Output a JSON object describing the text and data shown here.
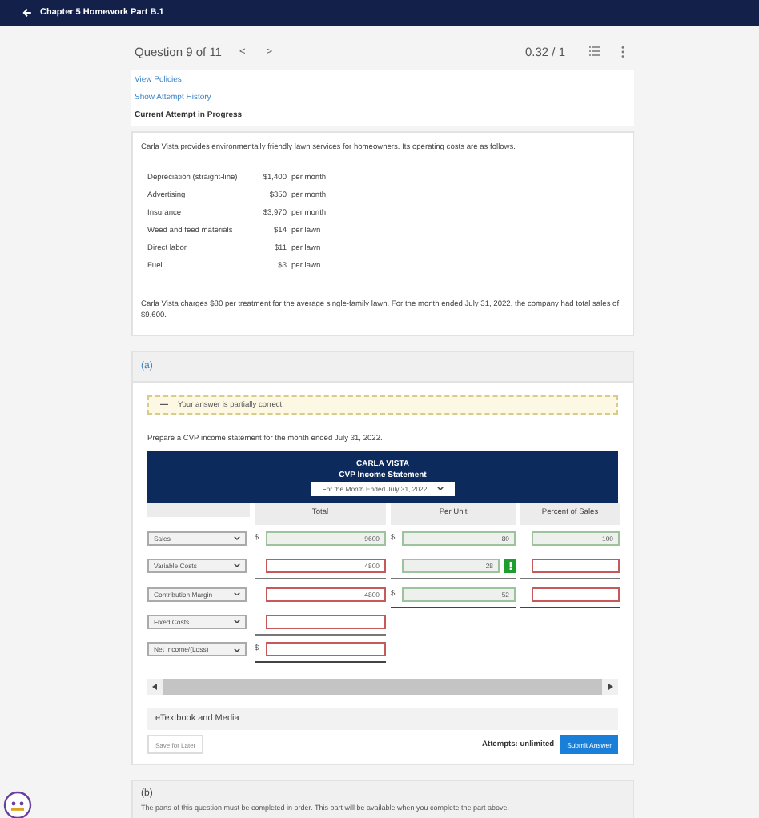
{
  "header": {
    "title": "Chapter 5 Homework Part B.1"
  },
  "question": {
    "label": "Question 9 of 11",
    "prev": "<",
    "next": ">",
    "score": "0.32 / 1"
  },
  "links": [
    "View Policies",
    "Show Attempt History"
  ],
  "attempt_heading": "Current Attempt in Progress",
  "problem": {
    "intro": "Carla Vista provides environmentally friendly lawn services for homeowners. Its operating costs are as follows.",
    "costs": [
      {
        "item": "Depreciation (straight-line)",
        "amount": "$1,400",
        "basis": "per month"
      },
      {
        "item": "Advertising",
        "amount": "$350",
        "basis": "per month"
      },
      {
        "item": "Insurance",
        "amount": "$3,970",
        "basis": "per month"
      },
      {
        "item": "Weed and feed materials",
        "amount": "$14",
        "basis": "per lawn"
      },
      {
        "item": "Direct labor",
        "amount": "$11",
        "basis": "per lawn"
      },
      {
        "item": "Fuel",
        "amount": "$3",
        "basis": "per lawn"
      }
    ],
    "closing": "Carla Vista charges $80 per treatment for the average single-family lawn. For the month ended July 31, 2022, the company had total sales of $9,600."
  },
  "part_a": {
    "label": "(a)",
    "feedback": {
      "sign": "—",
      "text": "Your answer is partially correct."
    },
    "instruction": "Prepare a CVP income statement for the month ended July 31, 2022.",
    "statement": {
      "company": "CARLA VISTA",
      "title": "CVP Income Statement",
      "period": "For the Month Ended July 31, 2022",
      "columns": [
        "Total",
        "Per Unit",
        "Percent of Sales"
      ],
      "rows": [
        {
          "label": "Sales",
          "cells": [
            {
              "prefix": "$",
              "value": "9600",
              "correct": true,
              "ruled": false,
              "flagged": false
            },
            {
              "prefix": "$",
              "value": "80",
              "correct": true,
              "ruled": false,
              "flagged": false
            },
            {
              "value": "100",
              "correct": true,
              "ruled": false,
              "flagged": false
            }
          ]
        },
        {
          "label": "Variable Costs",
          "cells": [
            {
              "value": "4800",
              "correct": false,
              "ruled": true,
              "heavy_rule": false,
              "flagged": false
            },
            {
              "value": "28",
              "correct": true,
              "ruled": true,
              "heavy_rule": false,
              "flagged": true
            },
            {
              "correct": false,
              "ruled": true,
              "heavy_rule": false,
              "flagged": false
            }
          ]
        },
        {
          "label": "Contribution Margin",
          "cells": [
            {
              "value": "4800",
              "correct": false,
              "ruled": false,
              "flagged": false
            },
            {
              "prefix": "$",
              "value": "52",
              "correct": true,
              "ruled": true,
              "heavy_rule": true,
              "flagged": false
            },
            {
              "correct": false,
              "ruled": true,
              "heavy_rule": true,
              "flagged": false
            }
          ]
        },
        {
          "label": "Fixed Costs",
          "cells": [
            {
              "correct": false,
              "ruled": true,
              "heavy_rule": false,
              "flagged": false
            }
          ]
        },
        {
          "label": "Net Income/(Loss)",
          "cells": [
            {
              "prefix": "$",
              "correct": false,
              "ruled": true,
              "heavy_rule": true,
              "flagged": false
            }
          ]
        }
      ]
    },
    "etextbook": "eTextbook and Media",
    "save": "Save for Later",
    "attempts": "Attempts: unlimited",
    "submit": "Submit Answer"
  },
  "part_b": {
    "label": "(b)",
    "note": "The parts of this question must be completed in order. This part will be available when you complete the part above."
  }
}
